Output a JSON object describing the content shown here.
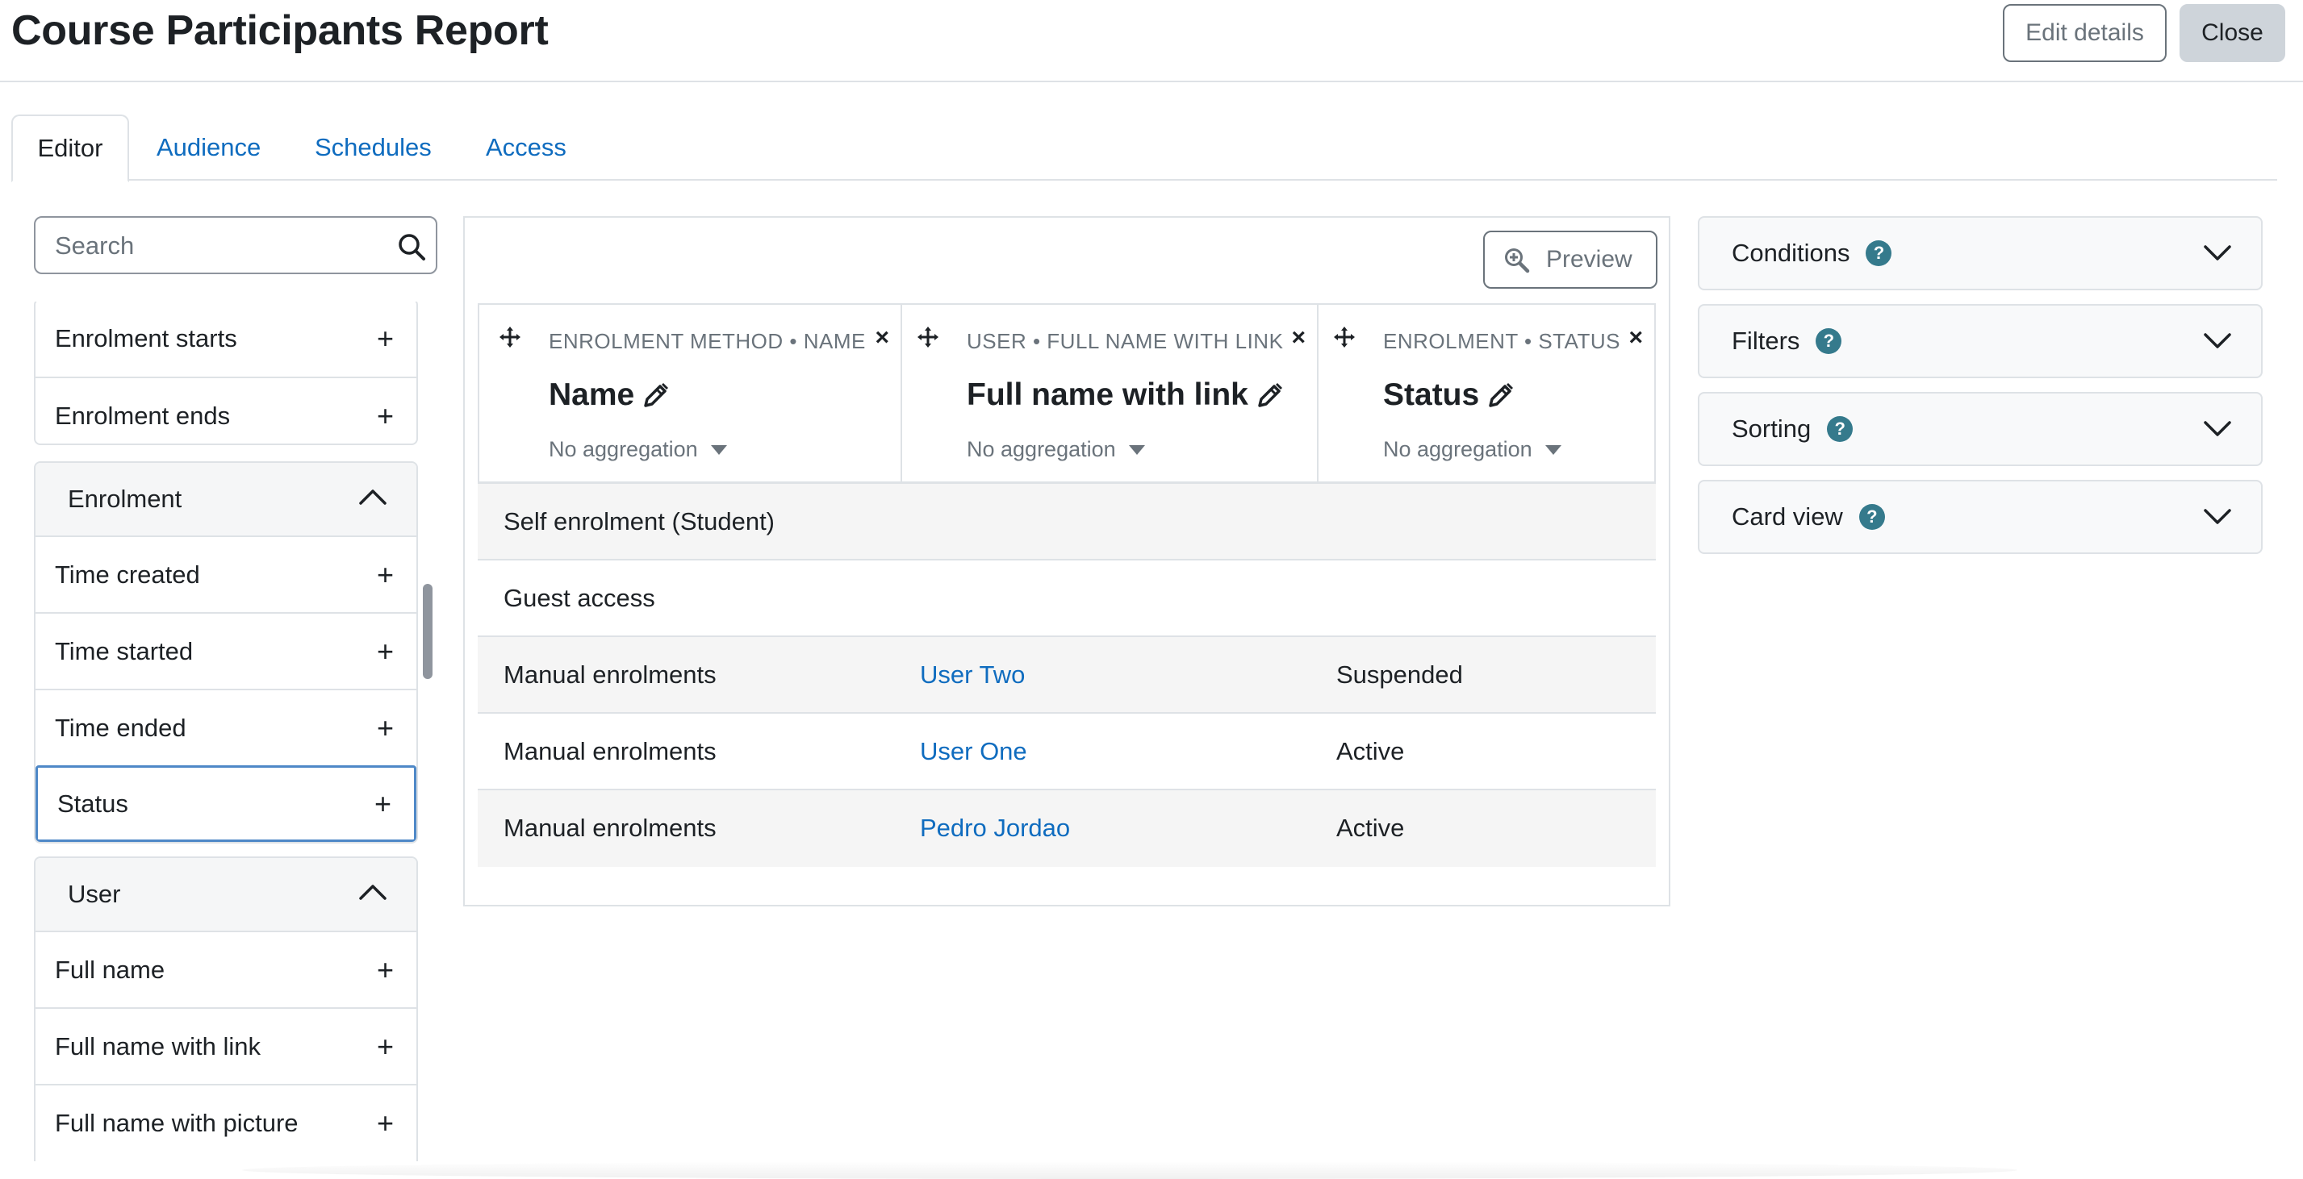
{
  "header": {
    "title": "Course Participants Report",
    "edit_label": "Edit details",
    "close_label": "Close"
  },
  "tabs": [
    {
      "label": "Editor",
      "active": true
    },
    {
      "label": "Audience"
    },
    {
      "label": "Schedules"
    },
    {
      "label": "Access"
    }
  ],
  "sidebar": {
    "search_placeholder": "Search",
    "group_top": {
      "items": [
        "Enrolment starts",
        "Enrolment ends"
      ]
    },
    "group_enrolment": {
      "title": "Enrolment",
      "items": [
        "Time created",
        "Time started",
        "Time ended",
        "Status"
      ]
    },
    "group_user": {
      "title": "User",
      "items": [
        "Full name",
        "Full name with link",
        "Full name with picture"
      ]
    }
  },
  "preview_label": "Preview",
  "columns": [
    {
      "meta": "ENROLMENT METHOD • NAME",
      "title": "Name",
      "aggregation": "No aggregation"
    },
    {
      "meta": "USER • FULL NAME WITH LINK",
      "title": "Full name with link",
      "aggregation": "No aggregation"
    },
    {
      "meta": "ENROLMENT • STATUS",
      "title": "Status",
      "aggregation": "No aggregation"
    }
  ],
  "rows": [
    {
      "name": "Self enrolment (Student)",
      "user": "",
      "status": ""
    },
    {
      "name": "Guest access",
      "user": "",
      "status": ""
    },
    {
      "name": "Manual enrolments",
      "user": "User Two",
      "status": "Suspended"
    },
    {
      "name": "Manual enrolments",
      "user": "User One",
      "status": "Active"
    },
    {
      "name": "Manual enrolments",
      "user": "Pedro Jordao",
      "status": "Active"
    }
  ],
  "panels": [
    {
      "label": "Conditions"
    },
    {
      "label": "Filters"
    },
    {
      "label": "Sorting"
    },
    {
      "label": "Card view"
    }
  ],
  "help_glyph": "?",
  "plus_glyph": "+",
  "remove_glyph": "×",
  "icons": {
    "search": "search-icon",
    "move": "move-icon",
    "edit": "pencil-icon",
    "chevron": "chevron-down-icon",
    "chevron_up": "chevron-up-icon",
    "zoom": "zoom-in-icon"
  },
  "colors": {
    "link": "#0f6cbf",
    "help_badge": "#357a8c",
    "selected_border": "#4e88c7"
  }
}
